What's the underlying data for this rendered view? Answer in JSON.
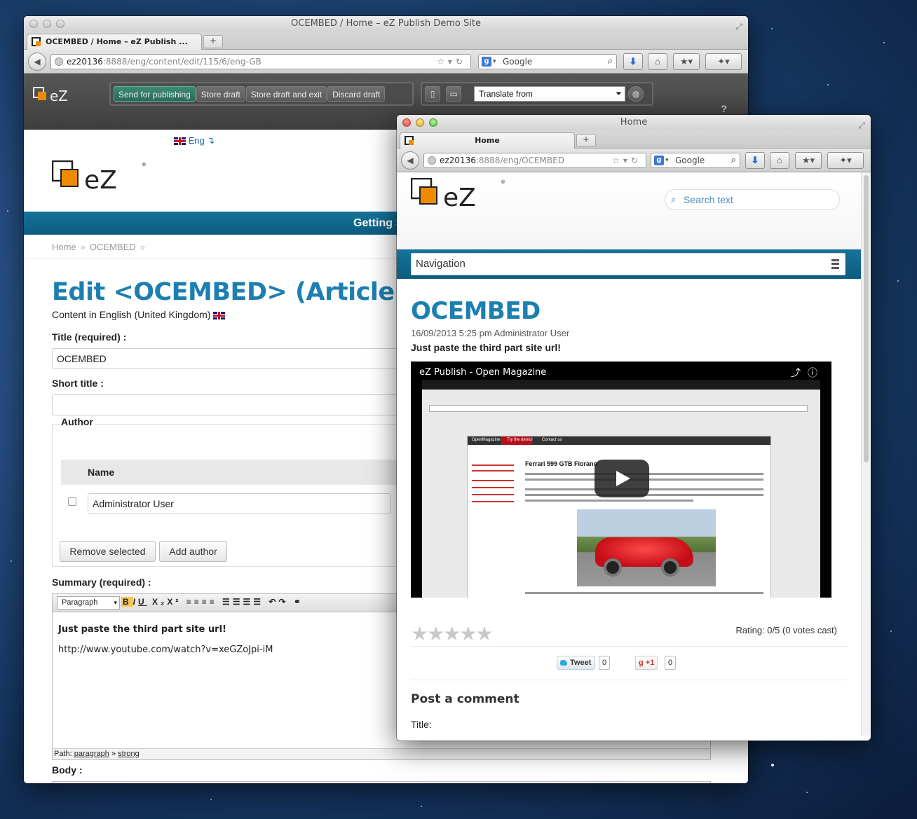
{
  "back_window": {
    "title": "OCEMBED / Home – eZ Publish Demo Site",
    "tab_label": "OCEMBED / Home – eZ Publish ...",
    "url_host": "ez20136",
    "url_rest": ":8888/eng/content/edit/115/6/eng-GB",
    "search_engine": "Google",
    "toolbar": {
      "send": "Send for publishing",
      "store": "Store draft",
      "store_exit": "Store draft and exit",
      "discard": "Discard draft",
      "translate_from": "Translate from",
      "help": "?"
    },
    "lang_label": "Eng ↴",
    "banner_text": "Getting S",
    "breadcrumb": [
      "Home",
      "OCEMBED"
    ],
    "breadcrumb_sep": "»",
    "edit_title": "Edit <OCEMBED> (Article)",
    "content_in": "Content in English (United Kingdom)",
    "title_label": "Title (required) :",
    "title_value": "OCEMBED",
    "short_title_label": "Short title :",
    "short_title_value": "",
    "author_legend": "Author",
    "author_col_name": "Name",
    "author_value": "Administrator User",
    "remove_selected": "Remove selected",
    "add_author": "Add author",
    "summary_label": "Summary (required) :",
    "paragraph_select": "Paragraph",
    "summary_line1": "Just paste the third part site url!",
    "summary_line2": "http://www.youtube.com/watch?v=xeGZoJpi-iM",
    "path_label": "Path:",
    "path_item1": "paragraph",
    "path_sep": "»",
    "path_item2": "strong",
    "body_label": "Body :"
  },
  "front_window": {
    "title": "Home",
    "tab_label": "Home",
    "url_host": "ez20136",
    "url_rest": ":8888/eng/OCEMBED",
    "search_engine": "Google",
    "search_placeholder": "Search text",
    "navigation_label": "Navigation",
    "article_title": "OCEMBED",
    "meta": "16/09/2013 5:25 pm Administrator User",
    "lead": "Just paste the third part site url!",
    "video_title": "eZ Publish - Open Magazine",
    "video_inner": {
      "article_title": "Ferrari 599 GTB Fiorano",
      "menu_items": [
        "OpenMagazine",
        "Try the demo!",
        "Contact us"
      ]
    },
    "stars_total": 5,
    "rating_text": "Rating: 0/5 (0 votes cast)",
    "tweet_label": "Tweet",
    "tweet_count": "0",
    "gplus_label": "+1",
    "gplus_count": "0",
    "post_comment": "Post a comment",
    "comment_title_label": "Title:"
  }
}
